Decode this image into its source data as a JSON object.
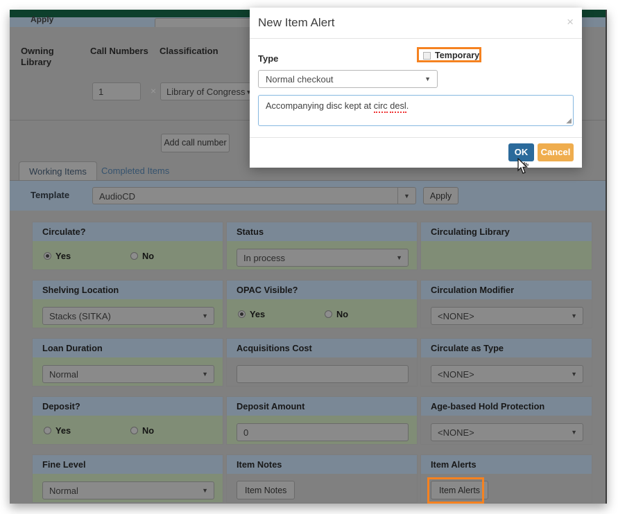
{
  "background_app": {
    "topbar_color": "#0d3f2c",
    "cut_row": {
      "label": "Apply"
    },
    "call_numbers": {
      "headers": [
        "Owning Library",
        "Call Numbers",
        "Classification"
      ],
      "owning_library": "Owning Library",
      "call_numbers_header": "Call Numbers",
      "classification_header": "Classification",
      "quantity_value": "1",
      "multiply_symbol": "×",
      "classification_value": "Library of Congress",
      "add_call_number_label": "Add call number"
    },
    "tabs": [
      {
        "label": "Working Items",
        "active": true
      },
      {
        "label": "Completed Items",
        "active": false
      }
    ],
    "template_row": {
      "label": "Template",
      "value": "AudioCD",
      "apply_label": "Apply"
    },
    "panels": [
      {
        "title": "Circulate?",
        "type": "radio",
        "yes": "Yes",
        "no": "No",
        "selected": "Yes"
      },
      {
        "title": "Status",
        "type": "select",
        "value": "In process"
      },
      {
        "title": "Circulating Library",
        "type": "empty",
        "value": ""
      },
      {
        "title": "Shelving Location",
        "type": "select",
        "value": "Stacks (SITKA)"
      },
      {
        "title": "OPAC Visible?",
        "type": "radio",
        "yes": "Yes",
        "no": "No",
        "selected": "Yes"
      },
      {
        "title": "Circulation Modifier",
        "type": "select",
        "value": "<NONE>"
      },
      {
        "title": "Loan Duration",
        "type": "select",
        "value": "Normal"
      },
      {
        "title": "Acquisitions Cost",
        "type": "input",
        "value": ""
      },
      {
        "title": "Circulate as Type",
        "type": "select",
        "value": "<NONE>"
      },
      {
        "title": "Deposit?",
        "type": "radio",
        "yes": "Yes",
        "no": "No",
        "selected": ""
      },
      {
        "title": "Deposit Amount",
        "type": "input",
        "value": "0"
      },
      {
        "title": "Age-based Hold Protection",
        "type": "select",
        "value": "<NONE>"
      },
      {
        "title": "Fine Level",
        "type": "select",
        "value": "Normal"
      },
      {
        "title": "Item Notes",
        "type": "button",
        "value": "Item Notes"
      },
      {
        "title": "Item Alerts",
        "type": "button",
        "value": "Item Alerts",
        "highlighted": true
      }
    ]
  },
  "modal": {
    "title": "New Item Alert",
    "close_label": "×",
    "type_label": "Type",
    "temporary_label": "Temporary",
    "temporary_checked": false,
    "type_value": "Normal checkout",
    "note_value_before": "Accompanying disc kept at ",
    "note_value_misspelled_1": "circ",
    "note_value_misspelled_2": "desl",
    "note_value_after": ".",
    "ok_label": "OK",
    "cancel_label": "Cancel"
  },
  "colors": {
    "accent_highlight": "#f58220",
    "primary_button": "#2b6a9b",
    "cancel_button": "#efad4e",
    "panel_header": "#7a8896",
    "panel_body": "#808d76",
    "app_background": "#808080",
    "topbar_green": "#0d3f2c"
  }
}
